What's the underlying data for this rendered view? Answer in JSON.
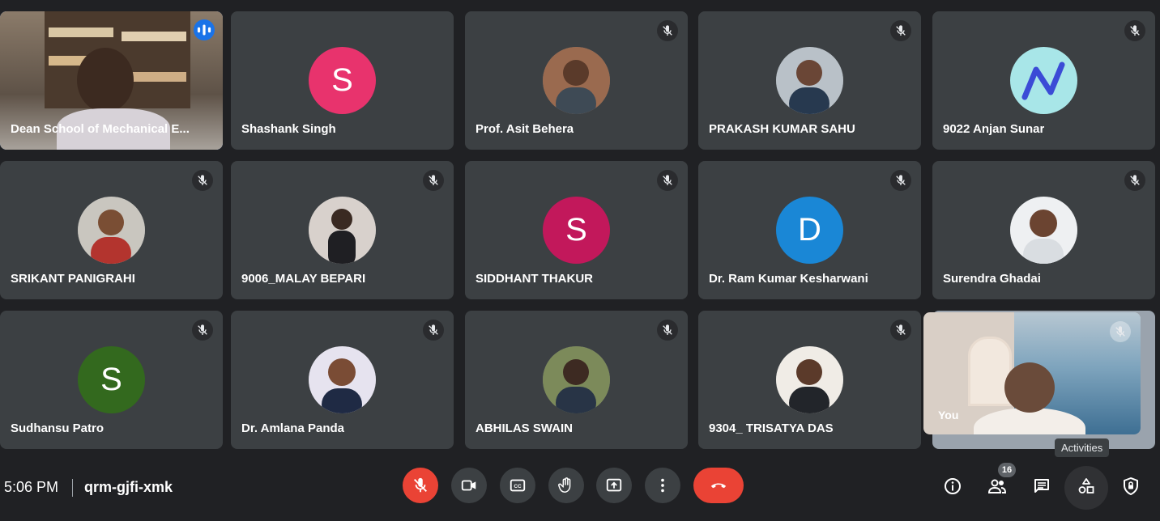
{
  "meeting": {
    "time": "5:06 PM",
    "code": "qrm-gjfi-xmk",
    "participant_count": "16",
    "tooltip": "Activities"
  },
  "participants": [
    {
      "name": "Dean School of Mechanical E...",
      "kind": "video"
    },
    {
      "name": "Shashank Singh",
      "kind": "letter",
      "letter": "S",
      "color": "#e8336d"
    },
    {
      "name": "Prof. Asit Behera",
      "kind": "photo"
    },
    {
      "name": "PRAKASH KUMAR SAHU",
      "kind": "photo"
    },
    {
      "name": "9022 Anjan Sunar",
      "kind": "logo"
    },
    {
      "name": "SRIKANT PANIGRAHI",
      "kind": "photo"
    },
    {
      "name": "9006_MALAY BEPARI",
      "kind": "photo"
    },
    {
      "name": "SIDDHANT THAKUR",
      "kind": "letter",
      "letter": "S",
      "color": "#c2185b"
    },
    {
      "name": "Dr. Ram Kumar Kesharwani",
      "kind": "letter",
      "letter": "D",
      "color": "#1a87d6"
    },
    {
      "name": "Surendra Ghadai",
      "kind": "photo"
    },
    {
      "name": "Sudhansu Patro",
      "kind": "letter",
      "letter": "S",
      "color": "#33691e"
    },
    {
      "name": "Dr. Amlana Panda",
      "kind": "photo"
    },
    {
      "name": "ABHILAS SWAIN",
      "kind": "photo"
    },
    {
      "name": "9304_ TRISATYA DAS",
      "kind": "photo"
    }
  ],
  "self_view": {
    "label": "You"
  },
  "icons": {
    "mic_off": "mic-off-icon",
    "camera": "camera-icon",
    "captions": "captions-icon",
    "hand": "raise-hand-icon",
    "present": "present-icon",
    "more": "more-vert-icon",
    "end": "end-call-icon",
    "info": "info-icon",
    "people": "people-icon",
    "chat": "chat-icon",
    "activities": "activities-icon",
    "host": "host-controls-icon"
  }
}
